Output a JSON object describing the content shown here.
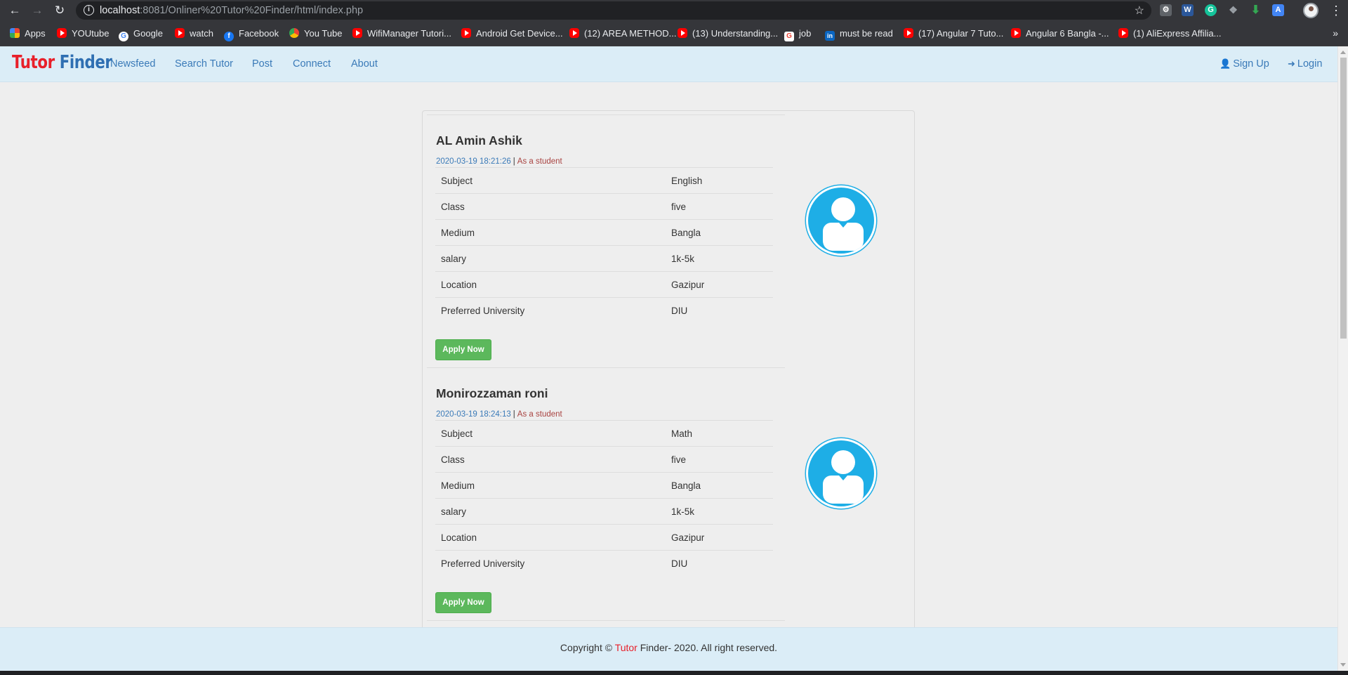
{
  "browser": {
    "url_host": "localhost",
    "url_rest": ":8081/Onliner%20Tutor%20Finder/html/index.php",
    "bookmarks": [
      {
        "label": "Apps",
        "icon": "apps-icon"
      },
      {
        "label": "YOUtube",
        "icon": "youtube-icon"
      },
      {
        "label": "Google",
        "icon": "google-icon"
      },
      {
        "label": "watch",
        "icon": "youtube-icon"
      },
      {
        "label": "Facebook",
        "icon": "facebook-icon"
      },
      {
        "label": "You Tube",
        "icon": "chrome-icon"
      },
      {
        "label": "WifiManager Tutori...",
        "icon": "youtube-icon"
      },
      {
        "label": "Android Get Device...",
        "icon": "youtube-icon"
      },
      {
        "label": "(12) AREA METHOD...",
        "icon": "youtube-icon"
      },
      {
        "label": "(13) Understanding...",
        "icon": "youtube-icon"
      },
      {
        "label": "job",
        "icon": "job-icon"
      },
      {
        "label": "must be read",
        "icon": "linkedin-icon"
      },
      {
        "label": "(17) Angular 7 Tuto...",
        "icon": "youtube-icon"
      },
      {
        "label": "Angular 6 Bangla -...",
        "icon": "youtube-icon"
      },
      {
        "label": "(1) AliExpress Affilia...",
        "icon": "youtube-icon"
      }
    ],
    "bookmarks_more": "»"
  },
  "site": {
    "brand_part1": "Tutor",
    "brand_part2": " Finder",
    "nav": [
      "Newsfeed",
      "Search Tutor",
      "Post",
      "Connect",
      "About"
    ],
    "signup": "Sign Up",
    "login": "Login",
    "accent_color": "#e8202a",
    "link_color": "#3a7ab8"
  },
  "posts": [
    {
      "name": "AL Amin Ashik",
      "date": "2020-03-19 18:21:26",
      "role": "As a student",
      "rows": [
        {
          "key": "Subject",
          "value": "English"
        },
        {
          "key": "Class",
          "value": "five"
        },
        {
          "key": "Medium",
          "value": "Bangla"
        },
        {
          "key": "salary",
          "value": "1k-5k"
        },
        {
          "key": "Location",
          "value": "Gazipur"
        },
        {
          "key": "Preferred University",
          "value": "DIU"
        }
      ],
      "button": "Apply Now"
    },
    {
      "name": "Monirozzaman roni",
      "date": "2020-03-19 18:24:13",
      "role": "As a student",
      "rows": [
        {
          "key": "Subject",
          "value": "Math"
        },
        {
          "key": "Class",
          "value": "five"
        },
        {
          "key": "Medium",
          "value": "Bangla"
        },
        {
          "key": "salary",
          "value": "1k-5k"
        },
        {
          "key": "Location",
          "value": "Gazipur"
        },
        {
          "key": "Preferred University",
          "value": "DIU"
        }
      ],
      "button": "Apply Now"
    }
  ],
  "footer": {
    "prefix": "Copyright © ",
    "brand": "Tutor",
    "suffix": " Finder- 2020. All right reserved."
  }
}
